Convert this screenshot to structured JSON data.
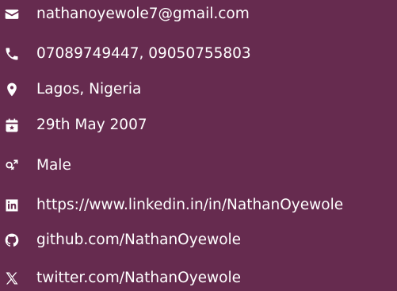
{
  "contact": {
    "items": [
      {
        "icon": "envelope-icon",
        "text": "nathanoyewole7@gmail.com"
      },
      {
        "icon": "phone-icon",
        "text": "07089749447, 09050755803"
      },
      {
        "icon": "location-pin-icon",
        "text": "Lagos, Nigeria"
      },
      {
        "icon": "calendar-icon",
        "text": "29th May 2007"
      },
      {
        "icon": "gender-icon",
        "text": "Male"
      },
      {
        "icon": "linkedin-icon",
        "text": "https://www.linkedin.in/in/NathanOyewole"
      },
      {
        "icon": "github-icon",
        "text": "github.com/NathanOyewole"
      },
      {
        "icon": "x-twitter-icon",
        "text": "twitter.com/NathanOyewole"
      }
    ]
  },
  "colors": {
    "background": "#662b4f",
    "text": "#ffffff"
  }
}
